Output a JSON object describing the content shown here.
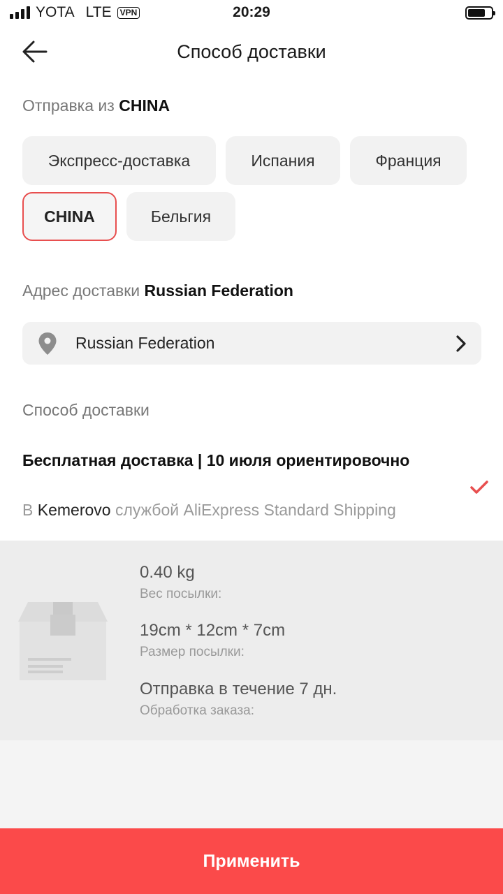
{
  "status_bar": {
    "carrier": "YOTA",
    "network": "LTE",
    "vpn": "VPN",
    "time": "20:29"
  },
  "header": {
    "title": "Способ доставки",
    "back_icon": "arrow-left-icon"
  },
  "ship_from": {
    "label": "Отправка из",
    "value": "CHINA",
    "options": [
      {
        "label": "Экспресс-доставка",
        "selected": false
      },
      {
        "label": "Испания",
        "selected": false
      },
      {
        "label": "Франция",
        "selected": false
      },
      {
        "label": "CHINA",
        "selected": true
      },
      {
        "label": "Бельгия",
        "selected": false
      }
    ]
  },
  "address": {
    "label": "Адрес доставки",
    "value": "Russian Federation",
    "field_value": "Russian Federation",
    "icon": "location-pin-icon"
  },
  "delivery_method": {
    "label": "Способ доставки",
    "option_title": "Бесплатная доставка | 10 июля ориентировочно",
    "sub_prefix": "В",
    "sub_city": "Kemerovo",
    "sub_suffix": "службой AliExpress Standard Shipping",
    "selected": true
  },
  "package": {
    "weight_value": "0.40 kg",
    "weight_label": "Вес посылки:",
    "size_value": "19cm * 12cm * 7cm",
    "size_label": "Размер посылки:",
    "processing_value": "Отправка в течение 7 дн.",
    "processing_label": "Обработка заказа:"
  },
  "apply_button": "Применить",
  "colors": {
    "accent": "#fb4a4a",
    "selected_border": "#e84f4f"
  }
}
